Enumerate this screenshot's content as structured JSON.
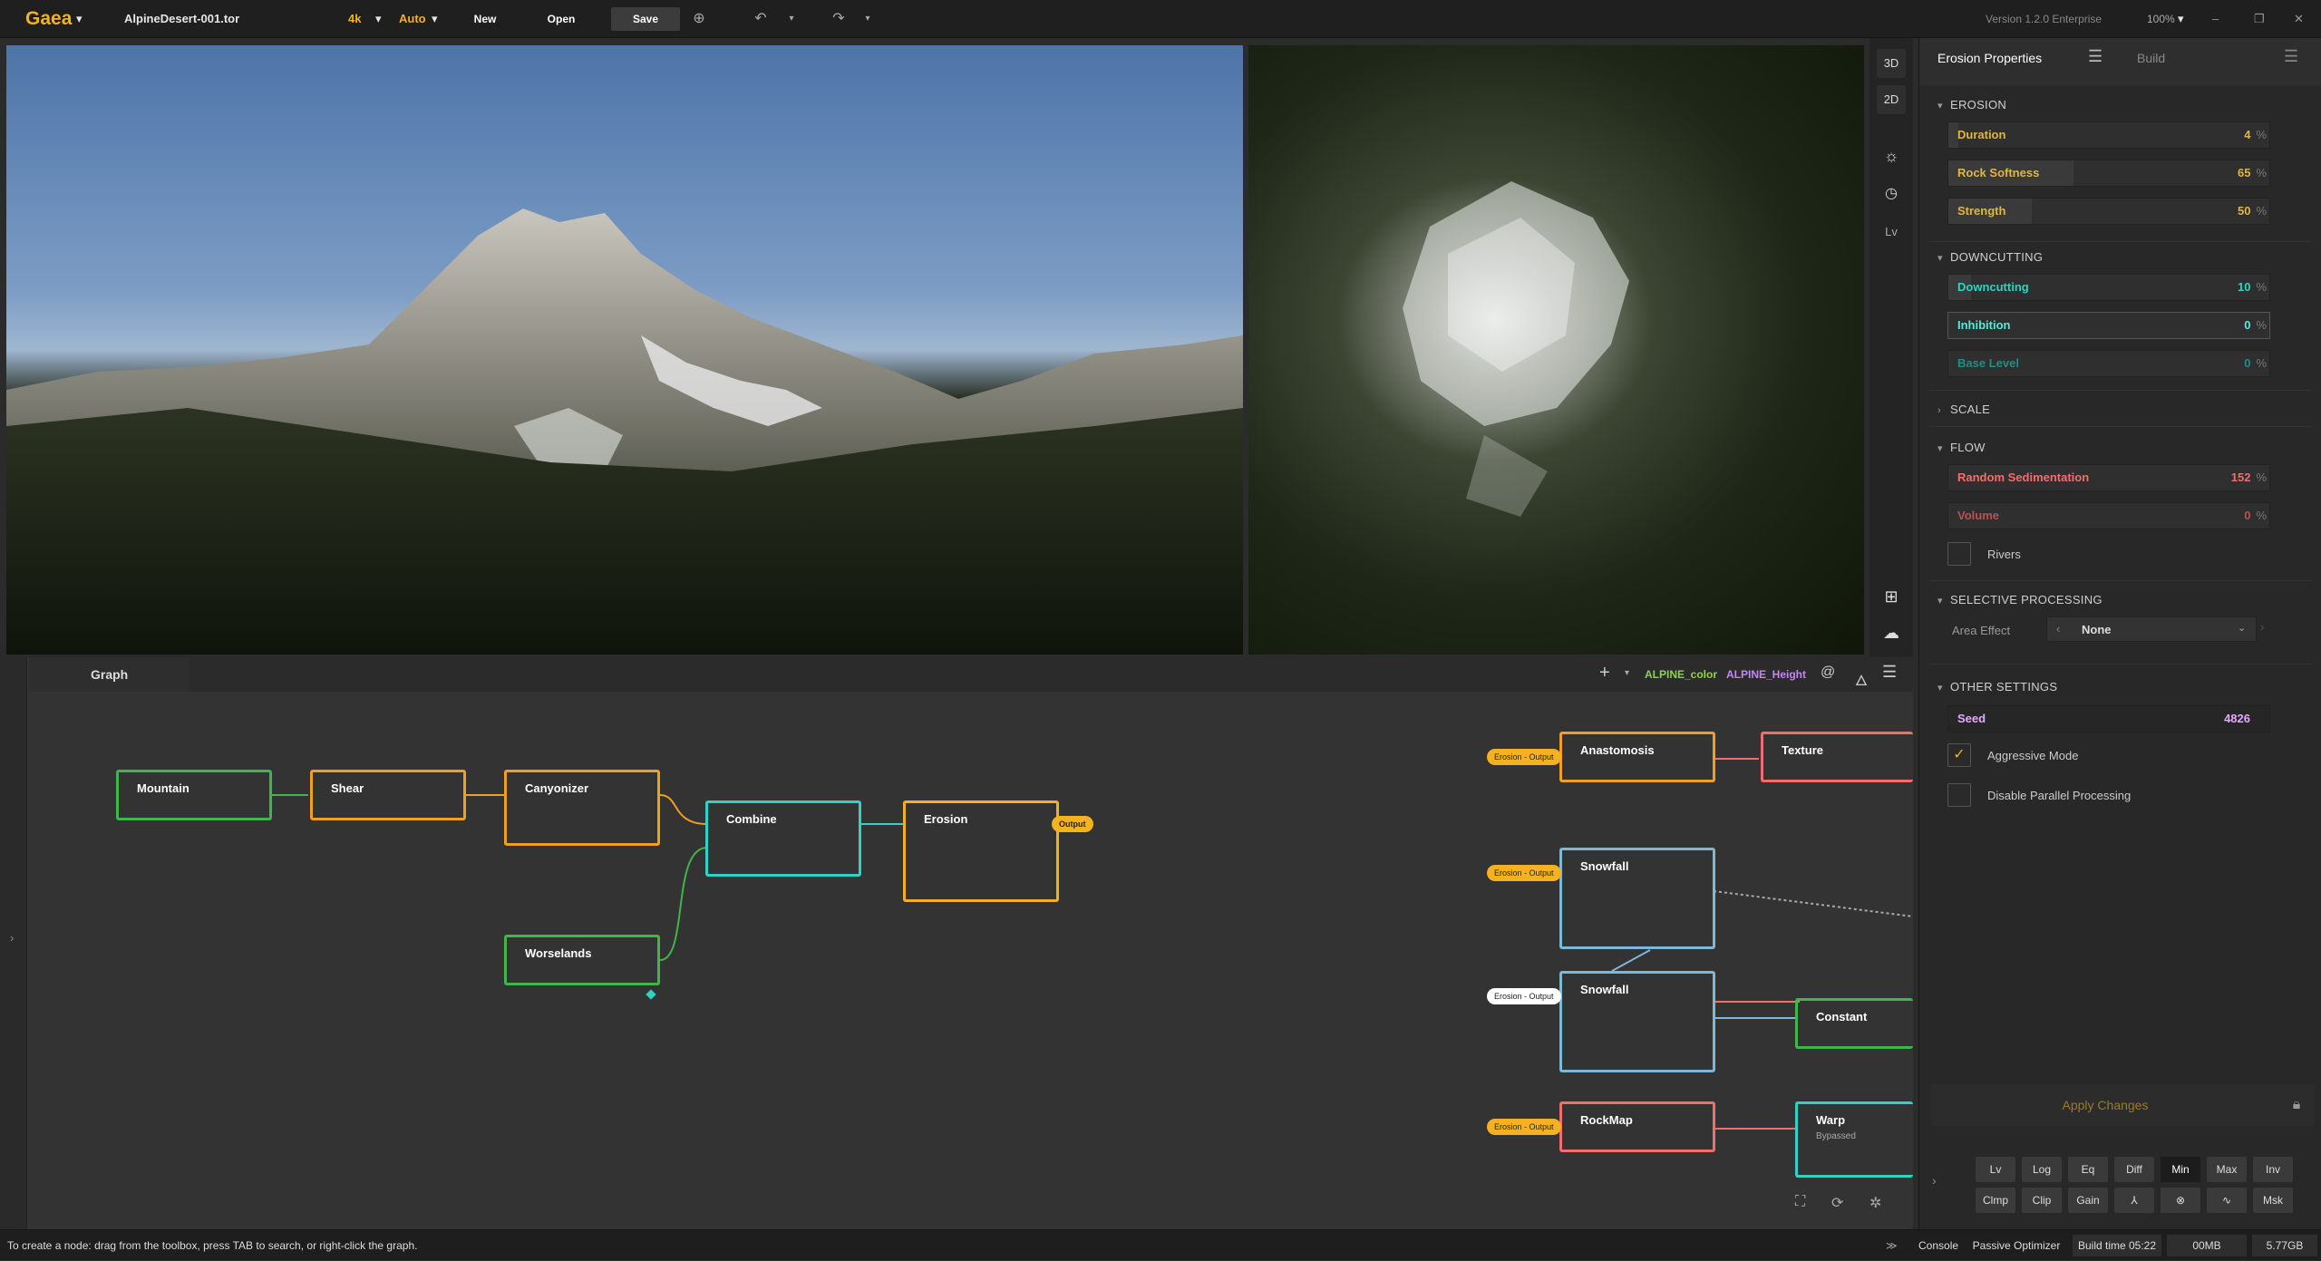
{
  "app": {
    "logo": "Gaea",
    "file_name": "AlpineDesert-001.tor",
    "resolution": "4k",
    "mode": "Auto",
    "new_label": "New",
    "open_label": "Open",
    "save_label": "Save",
    "version": "Version 1.2.0 Enterprise",
    "zoom": "100%"
  },
  "viewport_tools": {
    "btn_3d": "3D",
    "btn_2d": "2D",
    "btn_lv": "Lv"
  },
  "properties": {
    "tab_title": "Erosion Properties",
    "tab_build": "Build",
    "erosion": {
      "title": "EROSION",
      "duration_label": "Duration",
      "duration_value": "4",
      "rock_softness_label": "Rock Softness",
      "rock_softness_value": "65",
      "strength_label": "Strength",
      "strength_value": "50",
      "unit": "%"
    },
    "downcutting": {
      "title": "DOWNCUTTING",
      "downcutting_label": "Downcutting",
      "downcutting_value": "10",
      "inhibition_label": "Inhibition",
      "inhibition_value": "0",
      "base_level_label": "Base Level",
      "base_level_value": "0"
    },
    "scale": {
      "title": "SCALE"
    },
    "flow": {
      "title": "FLOW",
      "random_sed_label": "Random Sedimentation",
      "random_sed_value": "152",
      "volume_label": "Volume",
      "volume_value": "0",
      "rivers_label": "Rivers"
    },
    "selective": {
      "title": "SELECTIVE PROCESSING",
      "area_effect_label": "Area Effect",
      "area_effect_value": "None"
    },
    "other": {
      "title": "OTHER SETTINGS",
      "seed_label": "Seed",
      "seed_value": "4826",
      "aggressive_label": "Aggressive Mode",
      "disable_parallel_label": "Disable Parallel Processing"
    },
    "apply_label": "Apply Changes",
    "buttons_row1": [
      "Lv",
      "Log",
      "Eq",
      "Diff",
      "Min",
      "Max",
      "Inv"
    ],
    "buttons_row2": [
      "Clmp",
      "Clip",
      "Gain",
      "⅄",
      "⊗",
      "∿",
      "Msk"
    ],
    "colors": {
      "orange": "#f3b21f",
      "teal": "#2fd3c4",
      "pink": "#ef6a6a",
      "blue": "#4fb8ff"
    }
  },
  "graph": {
    "tab": "Graph",
    "color_map": "ALPINE_color",
    "height_map": "ALPINE_Height",
    "nodes": {
      "mountain": "Mountain",
      "shear": "Shear",
      "canyonizer": "Canyonizer",
      "combine": "Combine",
      "erosion": "Erosion",
      "worselands": "Worselands",
      "anastomosis": "Anastomosis",
      "texture": "Texture",
      "snowfall1": "Snowfall",
      "snowfall2": "Snowfall",
      "constant": "Constant",
      "rockmap": "RockMap",
      "warp": "Warp",
      "warp_sub": "Bypassed"
    },
    "output_label": "Output",
    "erosion_output": "Erosion - Output"
  },
  "status": {
    "hint": "To create a node: drag from the toolbox, press TAB to search, or right-click the graph.",
    "console": "Console",
    "optimizer": "Passive Optimizer",
    "build_time": "Build time 05:22",
    "memory": "00MB",
    "disk": "5.77GB"
  }
}
